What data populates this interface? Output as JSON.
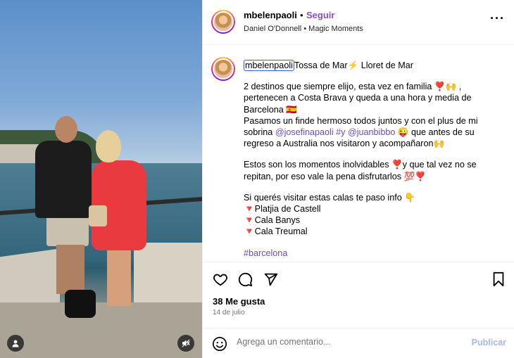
{
  "header": {
    "username": "mbelenpaoli",
    "separator": "•",
    "follow_label": "Seguir",
    "subtitle": "Daniel O'Donnell • Magic Moments",
    "more_icon": "more-horizontal-icon"
  },
  "caption": {
    "username": "mbelenpaoli",
    "lines": [
      "Tossa de Mar⚡️ Lloret de Mar",
      "",
      "2 destinos que siempre elijo, esta vez en familia ❣️🙌 ,",
      "pertenecen a Costa Brava y queda a una hora y media de",
      "Barcelona 🇪🇸",
      "Pasamos un finde hermoso todos juntos y con el plus de mi",
      "sobrina",
      "regreso a Australia nos visitaron y acompañaron🙌",
      "",
      "Estos son los momentos inolvidables ❣️y que tal vez no se",
      "repitan, por eso vale la pena disfrutarlos 💯❣️",
      "",
      "Si querés visitar estas calas te paso info 👇",
      "🔻Platjia de Castell",
      "🔻Cala Banys",
      "🔻Cala Treumal",
      ""
    ],
    "mention1": "@josefinapaoli",
    "mention_y": "#y",
    "mention2": "@juanbibbo",
    "after_mentions": " 😜 que antes de su",
    "hashtag": "#barcelona"
  },
  "actions": {
    "likes": "38 Me gusta",
    "date": "14 de julio"
  },
  "comment": {
    "placeholder": "Agrega un comentario...",
    "post_label": "Publicar"
  },
  "colors": {
    "follow": "#8a4bd8",
    "mention": "#6a4bd3",
    "post_disabled": "#a9b6e6"
  }
}
